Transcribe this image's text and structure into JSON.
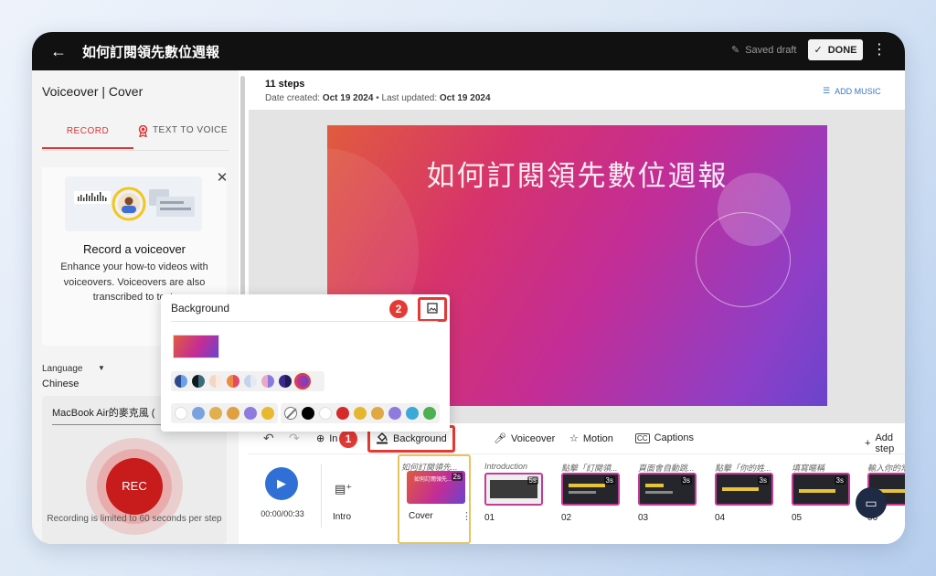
{
  "topbar": {
    "title": "如何訂閱領先數位週報",
    "saved_label": "Saved draft",
    "done_label": "DONE"
  },
  "left_panel": {
    "title": "Voiceover | Cover",
    "tabs": [
      {
        "label": "RECORD",
        "active": true
      },
      {
        "label": "TEXT TO VOICE",
        "active": false
      }
    ],
    "card": {
      "title": "Record a voiceover",
      "description": "Enhance your how-to videos with voiceovers. Voiceovers are also transcribed to text."
    },
    "language_label": "Language",
    "language_value": "Chinese",
    "mic_value": "MacBook Air的麥克風 (",
    "rec_label": "REC",
    "limit_text": "Recording is limited to 60 seconds per step"
  },
  "main": {
    "steps_count": "11 steps",
    "date_created_label": "Date created:",
    "date_created": "Oct 19 2024",
    "date_sep": "•",
    "last_updated_label": "Last updated:",
    "last_updated": "Oct 19 2024",
    "add_music_label": "ADD MUSIC",
    "slide_title": "如何訂閱領先數位週報"
  },
  "toolbar": {
    "intro_label": "In",
    "background_label": "Background",
    "voiceover_label": "Voiceover",
    "motion_label": "Motion",
    "captions_label": "Captions",
    "add_step_label": "Add step",
    "badge_1": "1",
    "badge_2": "2"
  },
  "timeline": {
    "time": "00:00/00:33",
    "intro_label": "Intro",
    "clips": [
      {
        "caption": "如何訂閱領先...",
        "duration": "2s",
        "label": "Cover"
      },
      {
        "caption": "Introduction",
        "duration": "5s",
        "label": "01"
      },
      {
        "caption": "點擊「訂閱領...",
        "duration": "3s",
        "label": "02"
      },
      {
        "caption": "頁面會自動跳...",
        "duration": "3s",
        "label": "03"
      },
      {
        "caption": "點擊「你的姓...",
        "duration": "3s",
        "label": "04"
      },
      {
        "caption": "填寫暱稱",
        "duration": "3s",
        "label": "05"
      },
      {
        "caption": "輸入你的常用...",
        "duration": "3s",
        "label": "06"
      }
    ]
  },
  "popup": {
    "title": "Background",
    "gradient_swatches": [
      "#2c4a8c",
      "#101820",
      "#f3d6c4",
      "#f08a3c",
      "#c6d3ee",
      "#e9a8c8",
      "#3b2a8a",
      "#c9308a"
    ],
    "color_swatches": [
      "#ffffff",
      "#7aa2e0",
      "#e0b050",
      "#e0a040",
      "#8f7ae0",
      "#e8b830"
    ],
    "solid_swatches": [
      "none",
      "#000000",
      "#ffffff",
      "#d42a2a",
      "#e6b62f",
      "#e0a842",
      "#8f7ae0",
      "#3aa9d8",
      "#4caf50"
    ]
  },
  "colors": {
    "accent_red": "#e53935",
    "primary_blue": "#2f6fd6"
  }
}
